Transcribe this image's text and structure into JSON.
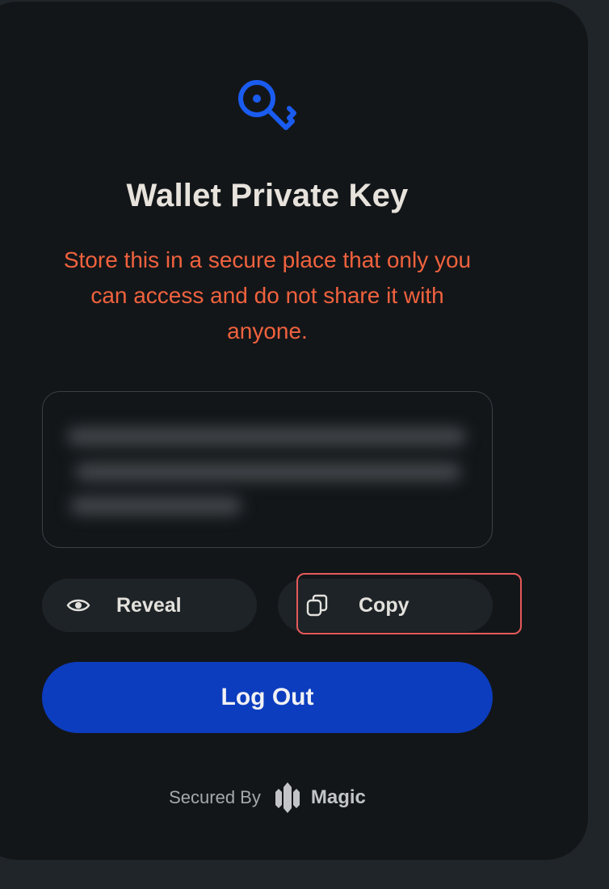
{
  "dialog": {
    "title": "Wallet Private Key",
    "warning": "Store this in a secure place that only you can access and do not share it with anyone.",
    "icon": "key-icon"
  },
  "key_field": {
    "state": "hidden (blurred)"
  },
  "buttons": {
    "reveal_label": "Reveal",
    "reveal_icon": "eye-icon",
    "copy_label": "Copy",
    "copy_icon": "copy-icon",
    "logout_label": "Log Out"
  },
  "footer": {
    "secured_by": "Secured By",
    "brand": "Magic",
    "brand_icon": "magic-logo-icon"
  },
  "colors": {
    "accent_blue": "#0c3dbf",
    "warning_orange": "#f0623e",
    "card_bg": "#131619",
    "page_bg": "#1f2528",
    "highlight_red": "#e65a5a"
  }
}
